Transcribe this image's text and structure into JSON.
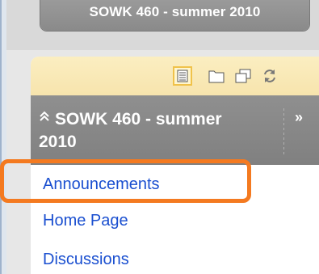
{
  "course": {
    "title": "SOWK 460 - summer 2010"
  },
  "toolbar": {
    "icons": [
      "list-view-icon",
      "folder-view-icon",
      "new-window-icon",
      "refresh-icon"
    ]
  },
  "menu": {
    "header_title": "SOWK 460 - summer 2010",
    "collapse_icon": "«",
    "expand_icon": "»",
    "items": [
      {
        "label": "Announcements",
        "highlighted": true
      },
      {
        "label": "Home Page",
        "highlighted": false
      },
      {
        "label": "Discussions",
        "highlighted": false
      }
    ]
  },
  "colors": {
    "link": "#1a4fd0",
    "highlight": "#f47a20",
    "toolbar": "#f7e4ad",
    "header": "#8a8a8a"
  }
}
